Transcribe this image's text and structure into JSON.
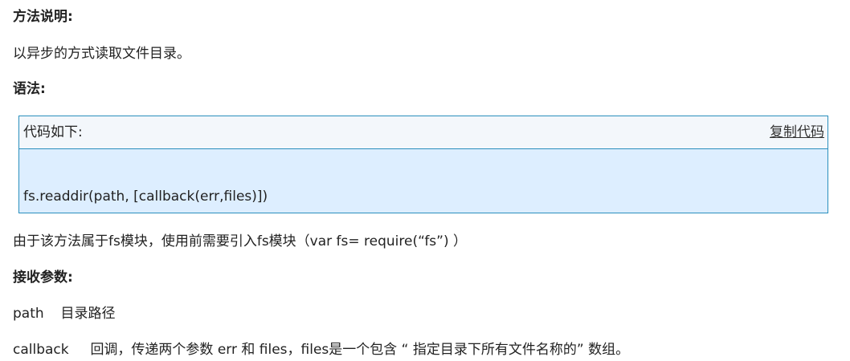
{
  "sections": {
    "method_heading": "方法说明:",
    "method_desc": "以异步的方式读取文件目录。",
    "syntax_heading": "语法:",
    "code_block": {
      "title": "代码如下:",
      "copy_label": "复制代码",
      "code": "fs.readdir(path, [callback(err,files)])"
    },
    "module_note": "由于该方法属于fs模块，使用前需要引入fs模块（var fs= require(“fs”) ）",
    "params_heading": "接收参数:",
    "params": [
      {
        "name": "path",
        "desc": "目录路径"
      },
      {
        "name": "callback",
        "desc": "回调，传递两个参数 err 和 files，files是一个包含 “ 指定目录下所有文件名称的” 数组。"
      }
    ]
  },
  "colors": {
    "code_border": "#2a8fbd",
    "code_header_bg": "#f3f7fb",
    "code_body_bg": "#ddeeff"
  }
}
